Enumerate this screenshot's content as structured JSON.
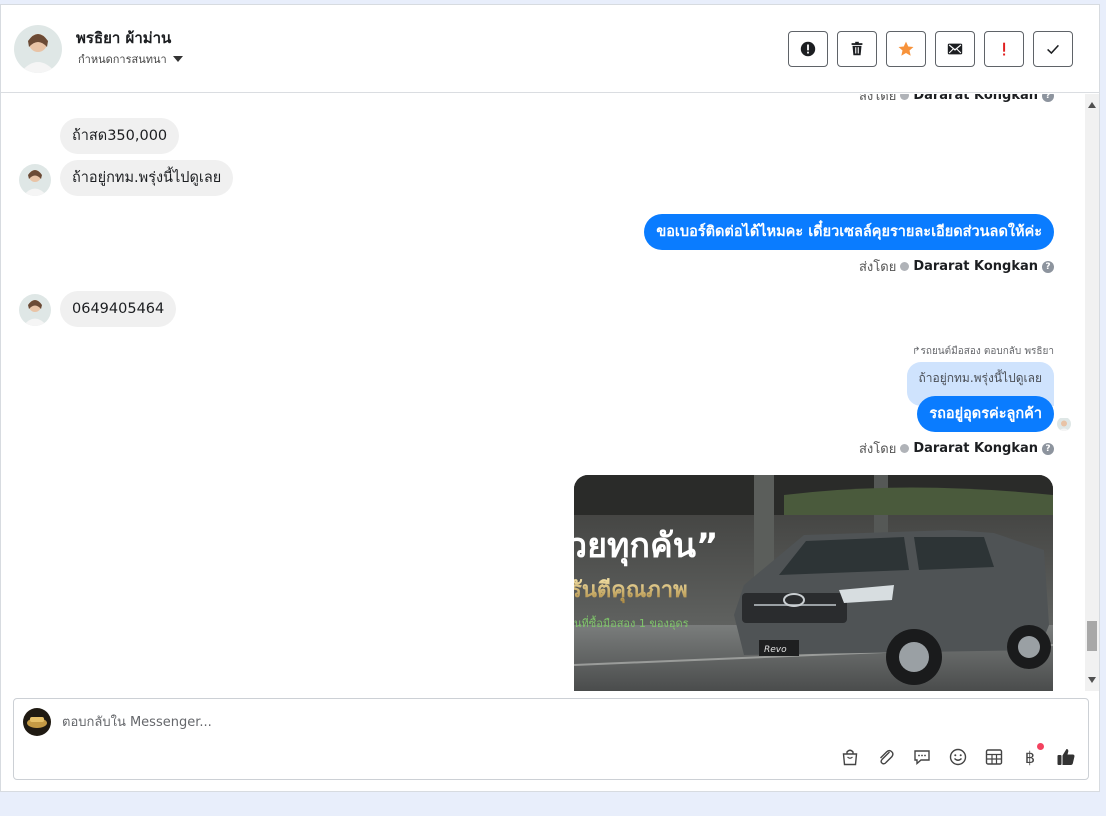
{
  "header": {
    "contact_name": "พรธิยา ผ้าม่าน",
    "assign_label": "กำหนดการสนทนา",
    "actions": [
      {
        "name": "spam-button",
        "icon": "alert-circle-icon"
      },
      {
        "name": "delete-button",
        "icon": "trash-icon"
      },
      {
        "name": "star-button",
        "icon": "star-icon",
        "color": "#f7923a"
      },
      {
        "name": "mark-unread-button",
        "icon": "envelope-icon"
      },
      {
        "name": "follow-up-button",
        "icon": "exclamation-icon",
        "color": "#e02020"
      },
      {
        "name": "mark-done-button",
        "icon": "check-icon"
      }
    ]
  },
  "messages": {
    "top_sent_by": "ส่งโดย",
    "top_agent": "Dararat Kongkan",
    "in_1": "ถ้าสด350,000",
    "in_2": "ถ้าอยู่กทม.พรุ่งนี้ไปดูเลย",
    "out_1": "ขอเบอร์ติดต่อได้ไหมคะ เดี๋ยวเซลล์คุยรายละเอียดส่วนลดให้ค่ะ",
    "sent_by_label": "ส่งโดย",
    "agent_name": "Dararat Kongkan",
    "in_3": "0649405464",
    "reply_note": "รถยนต์มือสอง ตอบกลับ พรธิยา",
    "quoted_text": "ถ้าอยู่กทม.พรุ่งนี้ไปดูเลย",
    "out_2": "รถอยู่อุดรค่ะลูกค้า",
    "image_caption_line1": "วยทุกคัน”",
    "image_caption_line2": "รันตีคุณภาพ",
    "image_caption_line3": "นที่ซื้อมือสอง 1 ของอุดร",
    "image_badge": "Revo"
  },
  "composer": {
    "placeholder": "ตอบกลับใน Messenger...",
    "tools": [
      "bag-icon",
      "paperclip-icon",
      "saved-reply-icon",
      "emoji-icon",
      "template-icon",
      "baht-icon",
      "like-icon"
    ],
    "baht_symbol": "฿"
  },
  "colors": {
    "outgoing_bubble": "#0a7cff",
    "incoming_bubble": "#f0f0f0",
    "star": "#f7923a",
    "alert": "#e02020"
  }
}
